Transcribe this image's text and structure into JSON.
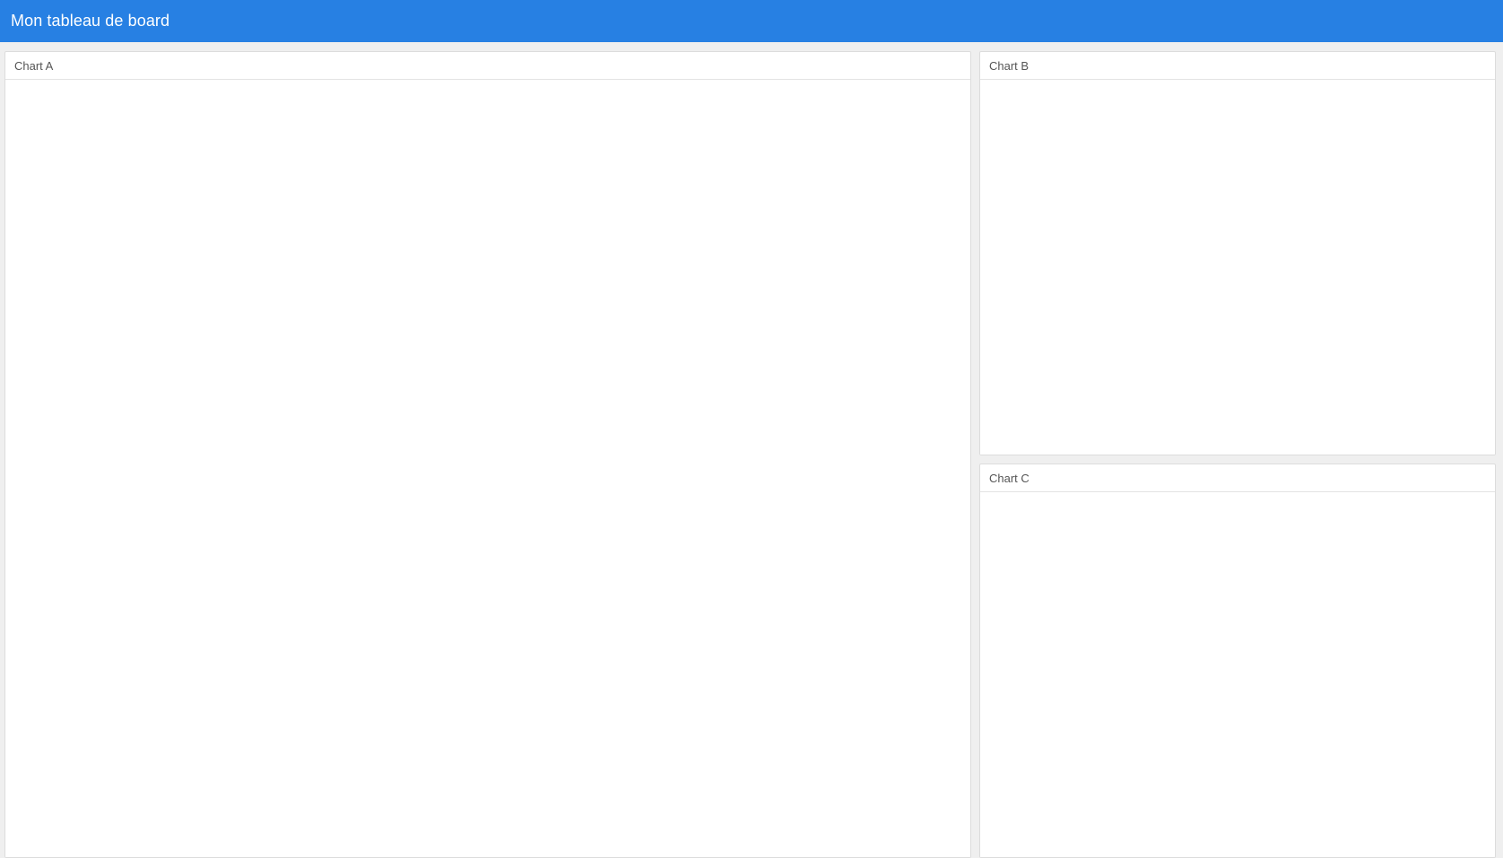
{
  "header": {
    "title": "Mon tableau de board"
  },
  "charts": [
    {
      "id": "chart-a",
      "title": "Chart A"
    },
    {
      "id": "chart-b",
      "title": "Chart B"
    },
    {
      "id": "chart-c",
      "title": "Chart C"
    }
  ],
  "colors": {
    "navbar": "#2780e3",
    "background": "#efefef",
    "card": "#ffffff",
    "card_border": "#dcdcdc",
    "header_text": "#555555"
  }
}
